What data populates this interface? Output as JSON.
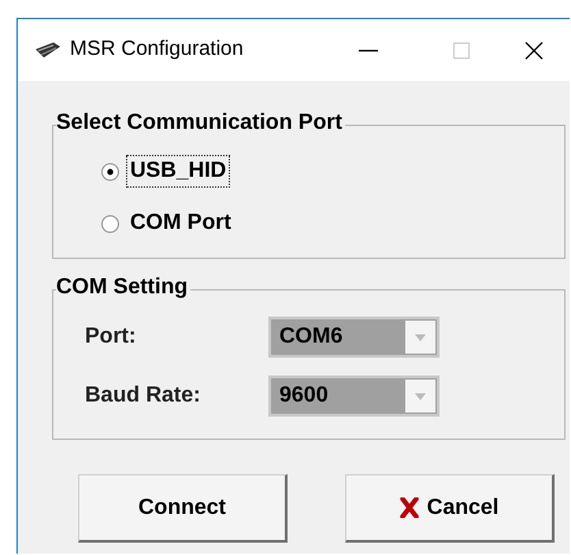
{
  "window": {
    "title": "MSR Configuration"
  },
  "communication_port": {
    "title": "Select Communication Port",
    "options": [
      {
        "label": "USB_HID",
        "selected": true
      },
      {
        "label": "COM Port",
        "selected": false
      }
    ]
  },
  "com_setting": {
    "title": "COM Setting",
    "fields": [
      {
        "label": "Port:",
        "value": "COM6",
        "disabled": true
      },
      {
        "label": "Baud Rate:",
        "value": "9600",
        "disabled": true
      }
    ]
  },
  "buttons": [
    {
      "label": "Connect",
      "kind": "plain"
    },
    {
      "label": "Cancel",
      "kind": "cancel"
    }
  ]
}
